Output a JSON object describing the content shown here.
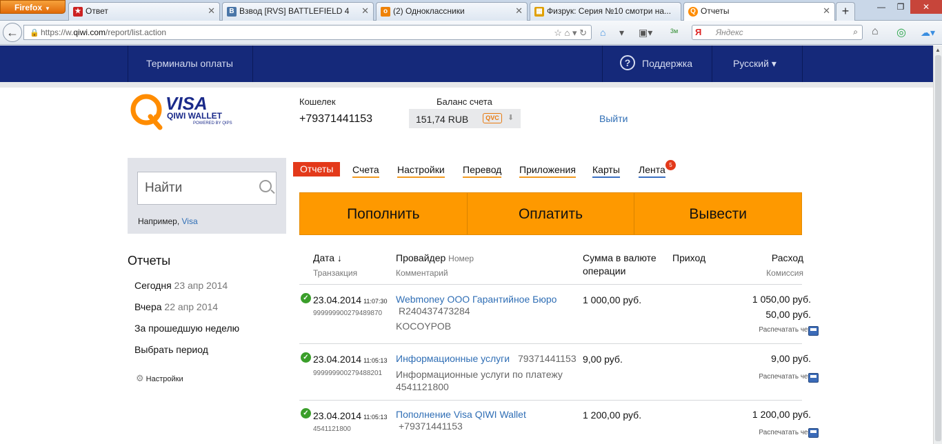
{
  "browser": {
    "menu_button": "Firefox",
    "tabs": [
      {
        "label": "Ответ",
        "icon": "star-icon",
        "color": "#cc2222"
      },
      {
        "label": "Взвод [RVS] BATTLEFIELD 4",
        "icon": "vk-icon",
        "color": "#4a76a8"
      },
      {
        "label": "(2) Одноклассники",
        "icon": "ok-icon",
        "color": "#ee8208"
      },
      {
        "label": "Физрук: Серия №10 смотри на...",
        "icon": "tv-icon",
        "color": "#e0a000"
      },
      {
        "label": "Отчеты",
        "icon": "qiwi-icon",
        "color": "#ff8c00"
      }
    ],
    "url_prefix": "https://w.",
    "url_domain": "qiwi.com",
    "url_path": "/report/list.action",
    "search_placeholder": "Яндекс",
    "search_logo": "Я",
    "toolbar_badge": "3м"
  },
  "header": {
    "terminals": "Терминалы оплаты",
    "support": "Поддержка",
    "language": "Русский ▾",
    "support_icon": "?"
  },
  "logo": {
    "brand": "VISA",
    "product": "QIWI WALLET",
    "sub": "POWERED BY QIPS"
  },
  "account": {
    "wallet_label": "Кошелек",
    "wallet_number": "+79371441153",
    "balance_label": "Баланс счета",
    "balance_value": "151,74 RUB",
    "qvc": "QVC",
    "logout": "Выйти"
  },
  "search": {
    "placeholder": "Найти",
    "example_prefix": "Например,",
    "example_link": "Visa"
  },
  "sidebar": {
    "title": "Отчеты",
    "today_label": "Сегодня",
    "today_date": "23 апр 2014",
    "yesterday_label": "Вчера",
    "yesterday_date": "22 апр 2014",
    "week": "За прошедшую неделю",
    "period": "Выбрать период",
    "settings": "Настройки"
  },
  "nav_tabs": {
    "reports": "Отчеты",
    "accounts": "Счета",
    "settings": "Настройки",
    "transfer": "Перевод",
    "apps": "Приложения",
    "cards": "Карты",
    "feed": "Лента",
    "feed_badge": "5"
  },
  "actions": {
    "topup": "Пополнить",
    "pay": "Оплатить",
    "withdraw": "Вывести"
  },
  "table": {
    "col_date": "Дата ↓",
    "col_txn": "Транзакция",
    "col_provider": "Провайдер",
    "col_number": "Номер",
    "col_comment": "Комментарий",
    "col_amount_1": "Сумма в валюте",
    "col_amount_2": "операции",
    "col_income": "Приход",
    "col_expense": "Расход",
    "col_commission": "Комиссия",
    "print_label": "Распечатать чек",
    "rows": [
      {
        "date": "23.04.2014",
        "time": "11:07:30",
        "txn": "999999900279489870",
        "provider": "Webmoney ООО Гарантийное Бюро",
        "number": "R240437473284",
        "comment": "KOCOYPOB",
        "amount": "1 000,00 руб.",
        "expense": "1 050,00 руб.",
        "commission": "50,00 руб."
      },
      {
        "date": "23.04.2014",
        "time": "11:05:13",
        "txn": "999999900279488201",
        "provider": "Информационные услуги",
        "number": "79371441153",
        "comment_1": "Информационные услуги по платежу",
        "comment_2": "4541121800",
        "amount": "9,00 руб.",
        "expense": "9,00 руб."
      },
      {
        "date": "23.04.2014",
        "time": "11:05:13",
        "txn": "4541121800",
        "provider": "Пополнение Visa QIWI Wallet",
        "number": "+79371441153",
        "amount": "1 200,00 руб.",
        "expense": "1 200,00 руб."
      }
    ]
  }
}
